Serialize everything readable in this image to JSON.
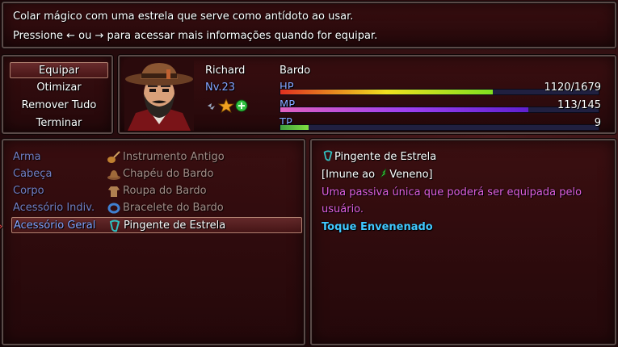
{
  "help": {
    "line1": "Colar mágico com uma estrela que serve como antídoto ao usar.",
    "line2": "Pressione ← ou → para acessar mais informações quando for equipar."
  },
  "commands": [
    {
      "label": "Equipar"
    },
    {
      "label": "Otimizar"
    },
    {
      "label": "Remover Tudo"
    },
    {
      "label": "Terminar"
    }
  ],
  "actor": {
    "name": "Richard",
    "class": "Bardo",
    "level": "Nv.23",
    "hp": {
      "label": "HP",
      "value": "1120/1679",
      "ratio": 0.667
    },
    "mp": {
      "label": "MP",
      "value": "113/145",
      "ratio": 0.779
    },
    "tp": {
      "label": "TP",
      "value": "9",
      "ratio": 0.09
    }
  },
  "slots": [
    {
      "label": "Arma",
      "item": "Instrumento Antigo",
      "icon": "lute-icon"
    },
    {
      "label": "Cabeça",
      "item": "Chapéu do Bardo",
      "icon": "hat-icon"
    },
    {
      "label": "Corpo",
      "item": "Roupa do Bardo",
      "icon": "robe-icon"
    },
    {
      "label": "Acessório Indiv.",
      "item": "Bracelete do Bardo",
      "icon": "bracelet-icon"
    },
    {
      "label": "Acessório Geral",
      "item": "Pingente de Estrela",
      "icon": "pendant-icon"
    }
  ],
  "detail": {
    "name": "Pingente de Estrela",
    "immune_prefix": "[Imune ao",
    "immune_state": "Veneno]",
    "description_line1": "Uma passiva única que poderá ser equipada pelo",
    "description_line2": "usuário.",
    "effect": "Toque Envenenado"
  },
  "colors": {
    "system_blue": "#84a4ff",
    "description_magenta": "#e060e0",
    "effect_cyan": "#40c8ff",
    "hp_gradient": [
      "#e03020",
      "#f0e020",
      "#80e020"
    ],
    "mp_gradient": [
      "#e060c0",
      "#a040f0",
      "#6020d0"
    ],
    "tp_gradient": [
      "#40a040",
      "#80e040"
    ]
  }
}
